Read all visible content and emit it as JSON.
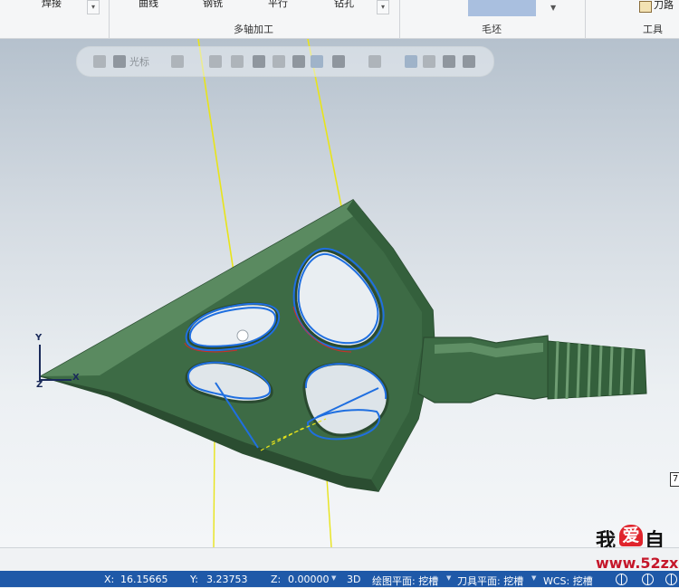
{
  "ribbon": {
    "items_cut": [
      "焊接",
      "曲线",
      "钢铣",
      "平行",
      "钻孔"
    ],
    "groups": {
      "multiaxis": "多轴加工",
      "stock": "毛坯",
      "tools": "工具"
    },
    "toolpath_label": "刀路",
    "colors": {
      "stock_swatch": "#a9bfdf",
      "background": "#f5f6f7"
    }
  },
  "toolbar": {
    "cursor_label": "光标",
    "icons": [
      "lock-icon",
      "cursor-select-icon",
      "dropdown-arrow-icon",
      "axis-move-icon",
      "pointer-icon",
      "solid-view-icon",
      "shaded-view-icon",
      "box-select-icon",
      "level-icon",
      "toolpath-icons"
    ]
  },
  "viewport": {
    "triad": {
      "y": "Y",
      "x": "X",
      "z": "Z"
    },
    "colors": {
      "part": "#3d6b45",
      "part_dark": "#2e5636",
      "toolpath": "#1f6fe0",
      "tool_axis": "#e8e41a",
      "background_top": "#b5c1cd"
    }
  },
  "watermark": {
    "left": "我",
    "heart": "爱",
    "right": "自",
    "url": "www.52zx",
    "corner": "7"
  },
  "status": {
    "x_label": "X:",
    "x_value": "16.15665",
    "y_label": "Y:",
    "y_value": "3.23753",
    "z_label": "Z:",
    "z_value": "0.00000",
    "mode": "3D",
    "plane_label": "绘图平面: 挖槽",
    "tool_plane_label": "刀具平面: 挖槽",
    "wcs_label": "WCS: 挖槽"
  }
}
